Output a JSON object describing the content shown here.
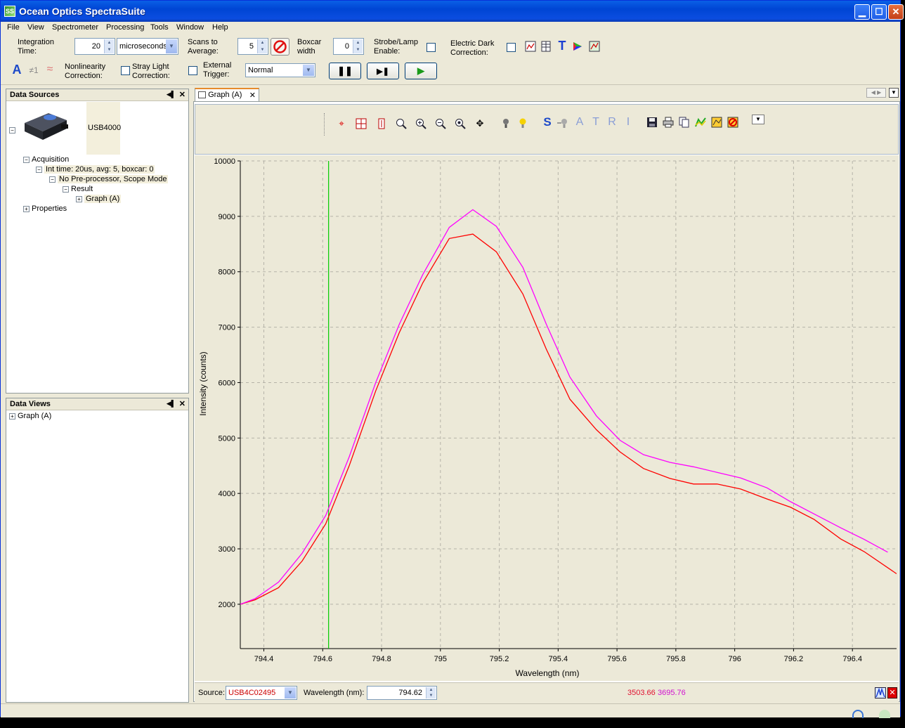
{
  "window": {
    "title": "Ocean Optics SpectraSuite",
    "app_icon": "SS"
  },
  "menu": [
    "File",
    "View",
    "Spectrometer",
    "Processing",
    "Tools",
    "Window",
    "Help"
  ],
  "acquisition_toolbar": {
    "integration_time_label_1": "Integration",
    "integration_time_label_2": "Time:",
    "integration_time_value": "20",
    "integration_time_unit": "microseconds",
    "scans_label_1": "Scans to",
    "scans_label_2": "Average:",
    "scans_value": "5",
    "boxcar_label_1": "Boxcar",
    "boxcar_label_2": "width",
    "boxcar_value": "0",
    "strobe_label_1": "Strobe/Lamp",
    "strobe_label_2": "Enable:",
    "edc_label_1": "Electric Dark",
    "edc_label_2": "Correction:",
    "nonlin_label_1": "Nonlinearity",
    "nonlin_label_2": "Correction:",
    "stray_label_1": "Stray Light",
    "stray_label_2": "Correction:",
    "ext_trigger_label_1": "External",
    "ext_trigger_label_2": "Trigger:",
    "trigger_mode": "Normal",
    "neq_glyph": "≠1"
  },
  "data_sources": {
    "title": "Data Sources",
    "device": "USB4000",
    "acquisition": "Acquisition",
    "int_time": "Int time: 20us, avg: 5, boxcar: 0",
    "preprocessor": "No Pre-processor, Scope Mode",
    "result": "Result",
    "graph": "Graph (A)",
    "properties": "Properties"
  },
  "data_views": {
    "title": "Data Views",
    "graph": "Graph (A)"
  },
  "graph_tab": {
    "label": "Graph (A)"
  },
  "graph_toolbar_letters": {
    "s": "S",
    "a": "A",
    "t": "T",
    "r": "R",
    "i": "I"
  },
  "statusbar": {
    "source_label": "Source:",
    "source_value": "USB4C02495",
    "wavelength_label": "Wavelength (nm):",
    "wavelength_value": "794.62",
    "cursor_value_1": "3503.66",
    "cursor_value_2": "3695.76"
  },
  "colors": {
    "series_red": "#ff0000",
    "series_magenta": "#ff00ff",
    "cursor_green": "#00cc00"
  },
  "chart_data": {
    "type": "line",
    "title": "",
    "xlabel": "Wavelength (nm)",
    "ylabel": "Intensity (counts)",
    "xlim": [
      794.32,
      796.55
    ],
    "ylim": [
      1200,
      10000
    ],
    "x_ticks": [
      "794.4",
      "794.6",
      "794.8",
      "795",
      "795.2",
      "795.4",
      "795.6",
      "795.8",
      "796",
      "796.2",
      "796.4"
    ],
    "y_ticks": [
      "2000",
      "3000",
      "4000",
      "5000",
      "6000",
      "7000",
      "8000",
      "9000",
      "10000"
    ],
    "grid": true,
    "cursor_x": 794.62,
    "series": [
      {
        "color": "#ff0000",
        "x": [
          794.32,
          794.37,
          794.45,
          794.53,
          794.61,
          794.69,
          794.78,
          794.86,
          794.94,
          795.03,
          795.11,
          795.19,
          795.28,
          795.36,
          795.44,
          795.53,
          795.61,
          795.69,
          795.78,
          795.86,
          795.94,
          796.02,
          796.11,
          796.19,
          796.27,
          796.36,
          796.44,
          796.55
        ],
        "y": [
          2000,
          2080,
          2300,
          2780,
          3450,
          4500,
          5850,
          6900,
          7800,
          8600,
          8680,
          8360,
          7600,
          6600,
          5700,
          5150,
          4750,
          4450,
          4270,
          4170,
          4170,
          4080,
          3900,
          3750,
          3530,
          3180,
          2950,
          2550
        ]
      },
      {
        "color": "#ff00ff",
        "x": [
          794.32,
          794.37,
          794.45,
          794.53,
          794.61,
          794.69,
          794.78,
          794.86,
          794.94,
          795.03,
          795.11,
          795.19,
          795.28,
          795.36,
          795.44,
          795.53,
          795.61,
          795.69,
          795.78,
          795.86,
          795.94,
          796.02,
          796.11,
          796.19,
          796.27,
          796.36,
          796.44,
          796.52
        ],
        "y": [
          2000,
          2100,
          2400,
          2920,
          3600,
          4660,
          6000,
          7050,
          7950,
          8800,
          9120,
          8820,
          8080,
          7050,
          6100,
          5400,
          4960,
          4700,
          4560,
          4480,
          4380,
          4280,
          4100,
          3850,
          3630,
          3380,
          3170,
          2940
        ]
      }
    ]
  }
}
